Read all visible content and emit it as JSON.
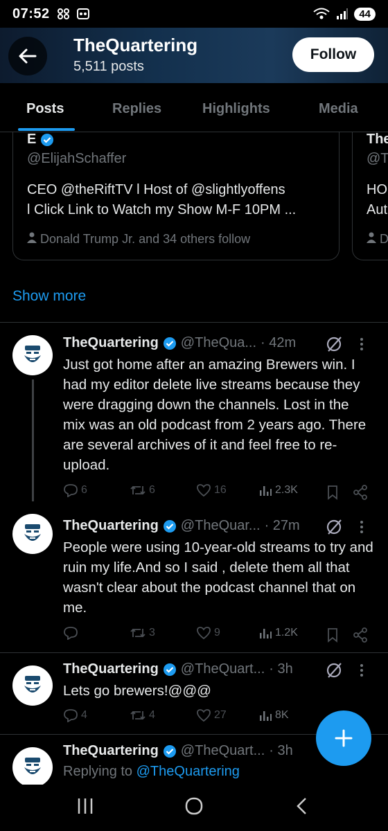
{
  "status": {
    "time": "07:52",
    "battery": "44"
  },
  "header": {
    "back_icon": "arrow-left-icon",
    "title": "TheQuartering",
    "subtitle": "5,511 posts",
    "follow_label": "Follow"
  },
  "tabs": [
    "Posts",
    "Replies",
    "Highlights",
    "Media"
  ],
  "suggestions": [
    {
      "name": "E",
      "handle": "@ElijahSchaffer",
      "bio_line1": "CEO @theRiftTV l Host of @slightlyoffens",
      "bio_line2": "l Click Link to Watch my Show M-F 10PM ...",
      "followers": "Donald Trump Jr. and 34 others follow"
    },
    {
      "name": "The",
      "handle": "@T",
      "bio_line1": "HO",
      "bio_line2": "Aut",
      "followers": "D"
    }
  ],
  "show_more": "Show more",
  "posts": [
    {
      "name": "TheQuartering",
      "handle": "@TheQua...",
      "time": "· 42m",
      "text": "Just got home after an amazing Brewers win. I had my editor delete live streams because they were dragging down the channels. Lost in the mix was an old podcast from 2 years ago. There are several archives of it and feel free to re-upload.",
      "replies": "6",
      "reposts": "6",
      "likes": "16",
      "views": "2.3K"
    },
    {
      "name": "TheQuartering",
      "handle": "@TheQuar...",
      "time": "· 27m",
      "text": "People were using 10-year-old streams to try and ruin my life.And so I said , delete them all that wasn't clear about the podcast channel that on me.",
      "replies": "",
      "reposts": "3",
      "likes": "9",
      "views": "1.2K"
    },
    {
      "name": "TheQuartering",
      "handle": "@TheQuart...",
      "time": "· 3h",
      "text": "Lets go brewers!@@@",
      "replies": "4",
      "reposts": "4",
      "likes": "27",
      "views": "8K"
    },
    {
      "name": "TheQuartering",
      "handle": "@TheQuart...",
      "time": "· 3h",
      "reply_prefix": "Replying to ",
      "reply_handle": "@TheQuartering"
    }
  ],
  "colors": {
    "accent": "#1d9bf0",
    "bg": "#000000",
    "muted": "#71767b",
    "text": "#e7e9ea"
  }
}
